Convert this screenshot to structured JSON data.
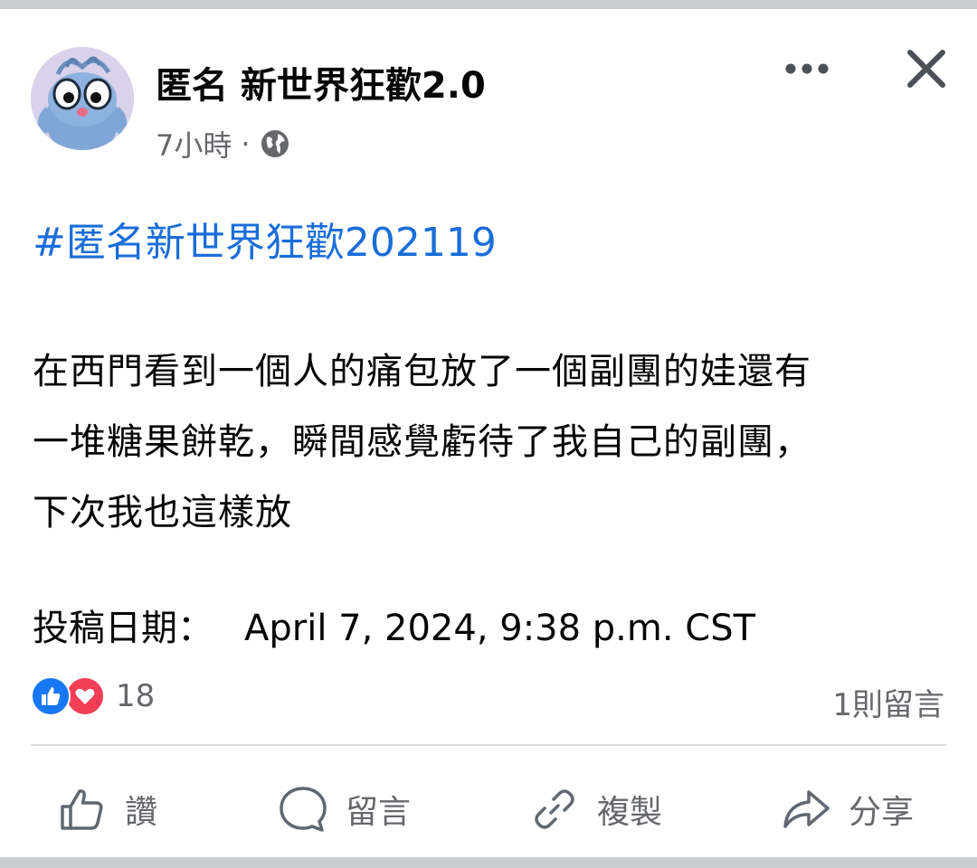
{
  "post": {
    "author": "匿名 新世界狂歡2.0",
    "time": "7小時",
    "separator": "·",
    "privacy_icon": "globe-icon",
    "hashtag": "#匿名新世界狂歡202119",
    "body_lines": [
      "在西門看到一個人的痛包放了一個副團的娃還有",
      "一堆糖果餅乾，瞬間感覺虧待了我自己的副團，",
      "下次我也這樣放"
    ],
    "date_label": "投稿日期：",
    "date_value": "April 7, 2024, 9:38 p.m. CST"
  },
  "reactions": {
    "icons": [
      "like-icon",
      "love-icon"
    ],
    "count": "18",
    "comments": "1則留言"
  },
  "actions": {
    "like": "讚",
    "comment": "留言",
    "copy": "複製",
    "share": "分享"
  },
  "colors": {
    "hashtag": "#1a6ed8",
    "like_blue": "#1877f2",
    "love_red": "#f33e58",
    "meta_gray": "#65676b"
  }
}
